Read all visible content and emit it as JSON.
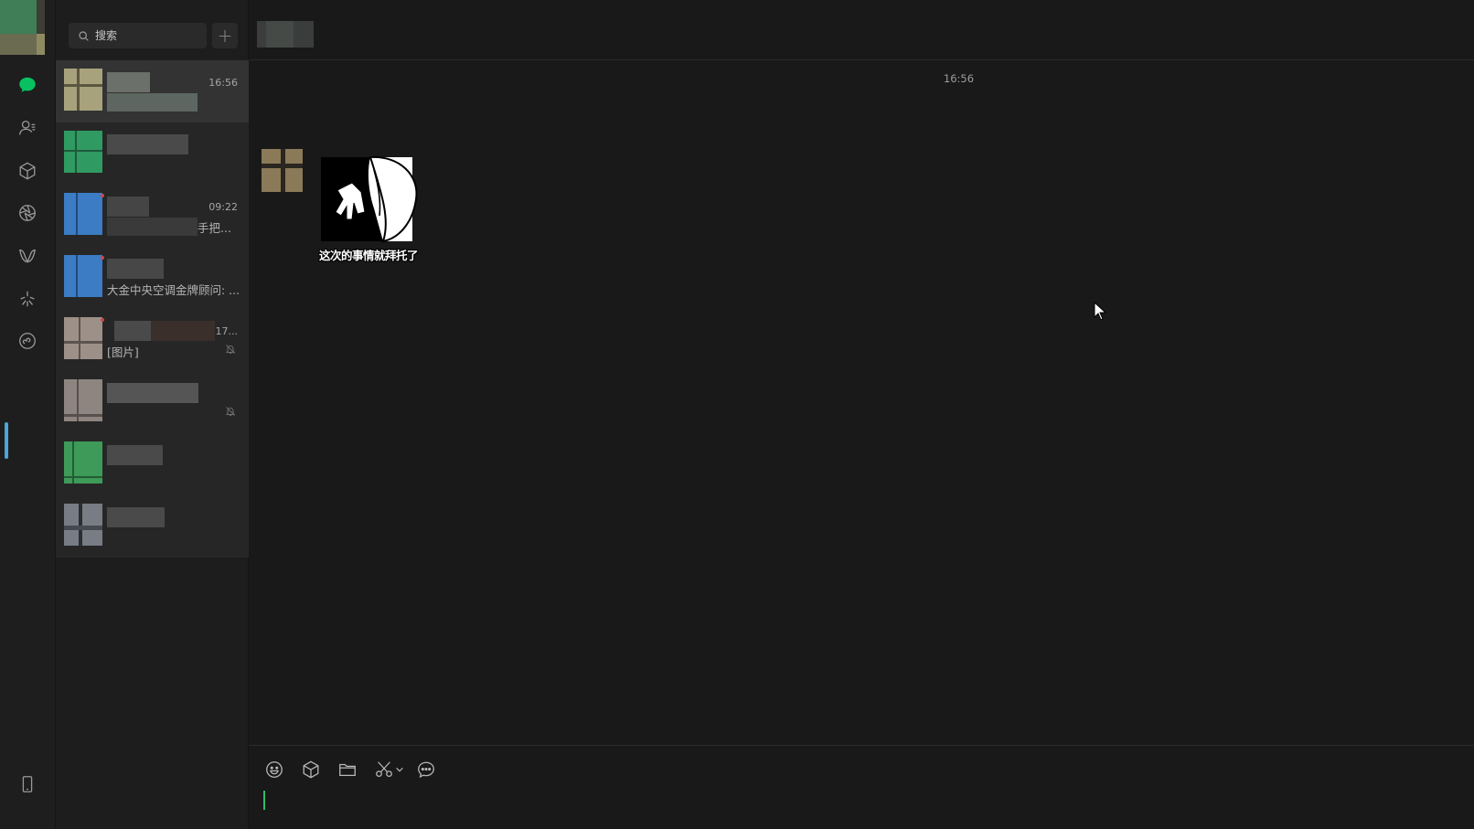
{
  "sidebar": {
    "nav_icons": [
      "chat-icon",
      "contacts-icon",
      "favorites-icon",
      "moments-icon",
      "channels-icon",
      "discover-icon",
      "mini-programs-icon",
      "phone-icon"
    ],
    "accent_color": "#07c160"
  },
  "search": {
    "placeholder": "搜索"
  },
  "conversations": [
    {
      "time": "16:56",
      "preview": ""
    },
    {
      "time": "",
      "preview": ""
    },
    {
      "time": "09:22",
      "preview": "手把..."
    },
    {
      "time": "",
      "preview": "大金中央空调金牌顾问: ..."
    },
    {
      "time": "17...",
      "preview": "[图片]"
    },
    {
      "time": "",
      "preview": ""
    },
    {
      "time": "",
      "preview": ""
    },
    {
      "time": "",
      "preview": ""
    }
  ],
  "chat": {
    "timestamp": "16:56",
    "sticker_caption": "这次的事情就拜托了"
  },
  "composer": {
    "tools": [
      "emoji-icon",
      "favorites-icon",
      "folder-icon",
      "scissors-icon",
      "chevron-down-icon",
      "chat-history-icon"
    ]
  }
}
